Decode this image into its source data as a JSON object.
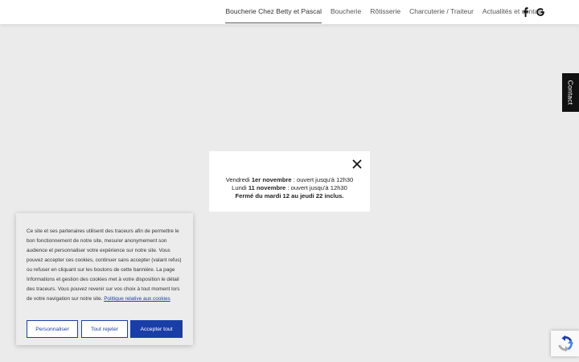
{
  "nav": {
    "items": [
      {
        "label": "Boucherie Chez Betty et Pascal",
        "active": true
      },
      {
        "label": "Boucherie",
        "active": false
      },
      {
        "label": "Rôtisserie",
        "active": false
      },
      {
        "label": "Charcuterie / Traiteur",
        "active": false
      },
      {
        "label": "Actualités et contact",
        "active": false
      }
    ],
    "social": [
      "facebook-icon",
      "google-icon"
    ]
  },
  "contact_tab": {
    "label": "Contact"
  },
  "modal": {
    "line1_prefix": "Vendredi ",
    "line1_bold": "1er novembre",
    "line1_suffix": " : ouvert jusqu'à 12h30",
    "line2_prefix": "Lundi ",
    "line2_bold": "11 novembre",
    "line2_suffix": " : ouvert jusqu'à 12h30",
    "line3": "Fermé du mardi 12 au jeudi 22 inclus."
  },
  "cookie_banner": {
    "text": "Ce site et ses partenaires utilisent des traceurs afin de permettre le bon fonctionnement de notre site, mesurer anonymement son audience et personnaliser votre expérience sur notre site. Vous pouvez accepter ces cookies, continuer sans accepter (valant refus) ou refuser en cliquant sur les boutons de cette bannière. La page Informations et gestion des cookies met à votre disposition le détail des traceurs. Vous pouvez revenir sur vos choix à tout moment lors de votre navigation sur notre site. ",
    "link": "Politique relative aux cookies",
    "customize_label": "Personnaliser",
    "reject_label": "Tout rejeter",
    "accept_label": "Accepter tout"
  },
  "colors": {
    "accent": "#1a3ea8",
    "header_bg": "#ffffff",
    "overlay_bg": "#ebebeb",
    "contact_tab_bg": "#111111"
  }
}
